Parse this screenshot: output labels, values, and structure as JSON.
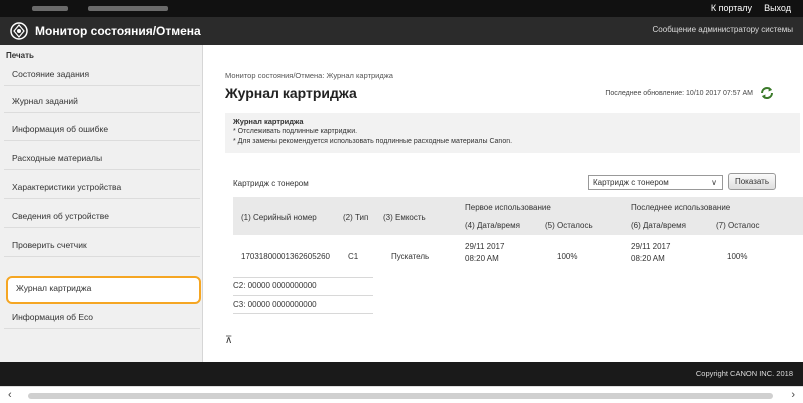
{
  "topbar": {
    "links": [
      "К порталу",
      "Выход"
    ]
  },
  "app": {
    "title": "Монитор состояния/Отмена",
    "admin_link": "Сообщение администратору системы"
  },
  "sidebar": {
    "section": "Печать",
    "items": [
      "Состояние задания",
      "Журнал заданий",
      "Информация об ошибке",
      "Расходные материалы",
      "Характеристики устройства",
      "Сведения об устройстве",
      "Проверить счетчик",
      "Журнал картриджа",
      "Информация об Eco"
    ],
    "active_index": 7
  },
  "main": {
    "breadcrumb": "Монитор состояния/Отмена: Журнал картриджа",
    "title": "Журнал картриджа",
    "last_updated": "Последнее обновление: 10/10 2017 07:57 AM",
    "info": {
      "heading": "Журнал картриджа",
      "line1": "* Отслеживать подлинные картриджи.",
      "line2": "* Для замены рекомендуется использовать подлинные расходные материалы Canon."
    },
    "cartridge_label": "Картридж с тонером",
    "select_value": "Картридж с тонером",
    "show_button": "Показать",
    "table": {
      "group_first": "Первое использование",
      "group_last": "Последнее использование",
      "headers": [
        "(1) Серийный номер",
        "(2) Тип",
        "(3) Емкость",
        "(4) Дата/время",
        "(5) Осталось",
        "(6) Дата/время",
        "(7) Осталос"
      ],
      "row": {
        "serial": "170318000013626",
        "serial_tail": "05260",
        "type": "C1",
        "capacity": "Пускатель",
        "first_date": "29/11 2017",
        "first_time": "08:20 AM",
        "first_left": "100%",
        "last_date": "29/11 2017",
        "last_time": "08:20 AM",
        "last_left": "100%"
      }
    },
    "c_lines": [
      "C2:   00000 0000000000",
      "C3:   00000 0000000000"
    ],
    "marker": "⊼"
  },
  "footer": {
    "copyright": "Copyright CANON INC. 2018"
  },
  "icons": {
    "logo": "canon-logo-icon",
    "refresh": "refresh-icon"
  },
  "colors": {
    "accent": "#f5a623",
    "topbar": "#111111",
    "titlebar": "#2b2b2b",
    "footer": "#1a1a1a"
  }
}
